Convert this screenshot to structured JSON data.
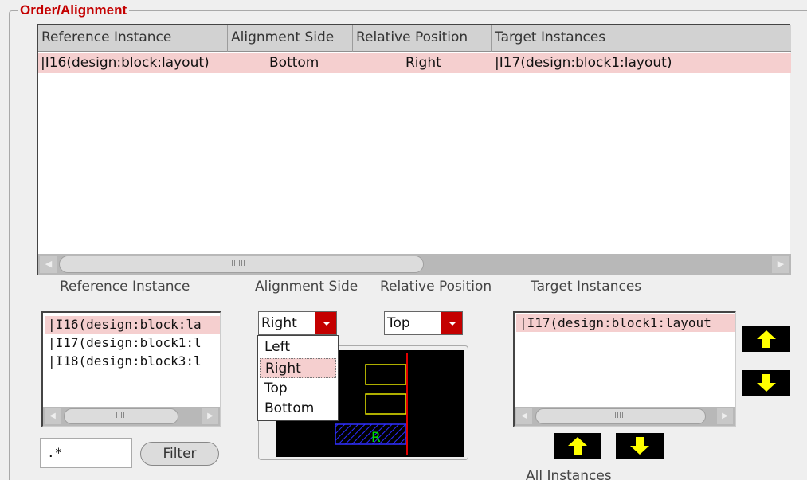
{
  "group": {
    "title": "Order/Alignment"
  },
  "table": {
    "columns": [
      "Reference Instance",
      "Alignment Side",
      "Relative Position",
      "Target Instances"
    ],
    "rows": [
      {
        "reference": "|I16(design:block:layout)",
        "side": "Bottom",
        "position": "Right",
        "targets": "|I17(design:block1:layout)"
      }
    ]
  },
  "labels": {
    "reference_instance": "Reference Instance",
    "alignment_side": "Alignment Side",
    "relative_position": "Relative Position",
    "target_instances": "Target Instances",
    "all_instances": "All Instances"
  },
  "reference_list": [
    "|I16(design:block:la",
    "|I17(design:block1:l",
    "|I18(design:block3:l"
  ],
  "target_list": [
    "|I17(design:block1:layout"
  ],
  "filter": {
    "value": ".*",
    "button": "Filter"
  },
  "alignment_side": {
    "value": "Right",
    "options": [
      "Left",
      "Right",
      "Top",
      "Bottom"
    ]
  },
  "relative_position": {
    "value": "Top"
  },
  "preview": {
    "marker": "R"
  },
  "colors": {
    "accent": "#c40000",
    "selection": "#f5cfcf",
    "arrow": "#ffff00"
  }
}
